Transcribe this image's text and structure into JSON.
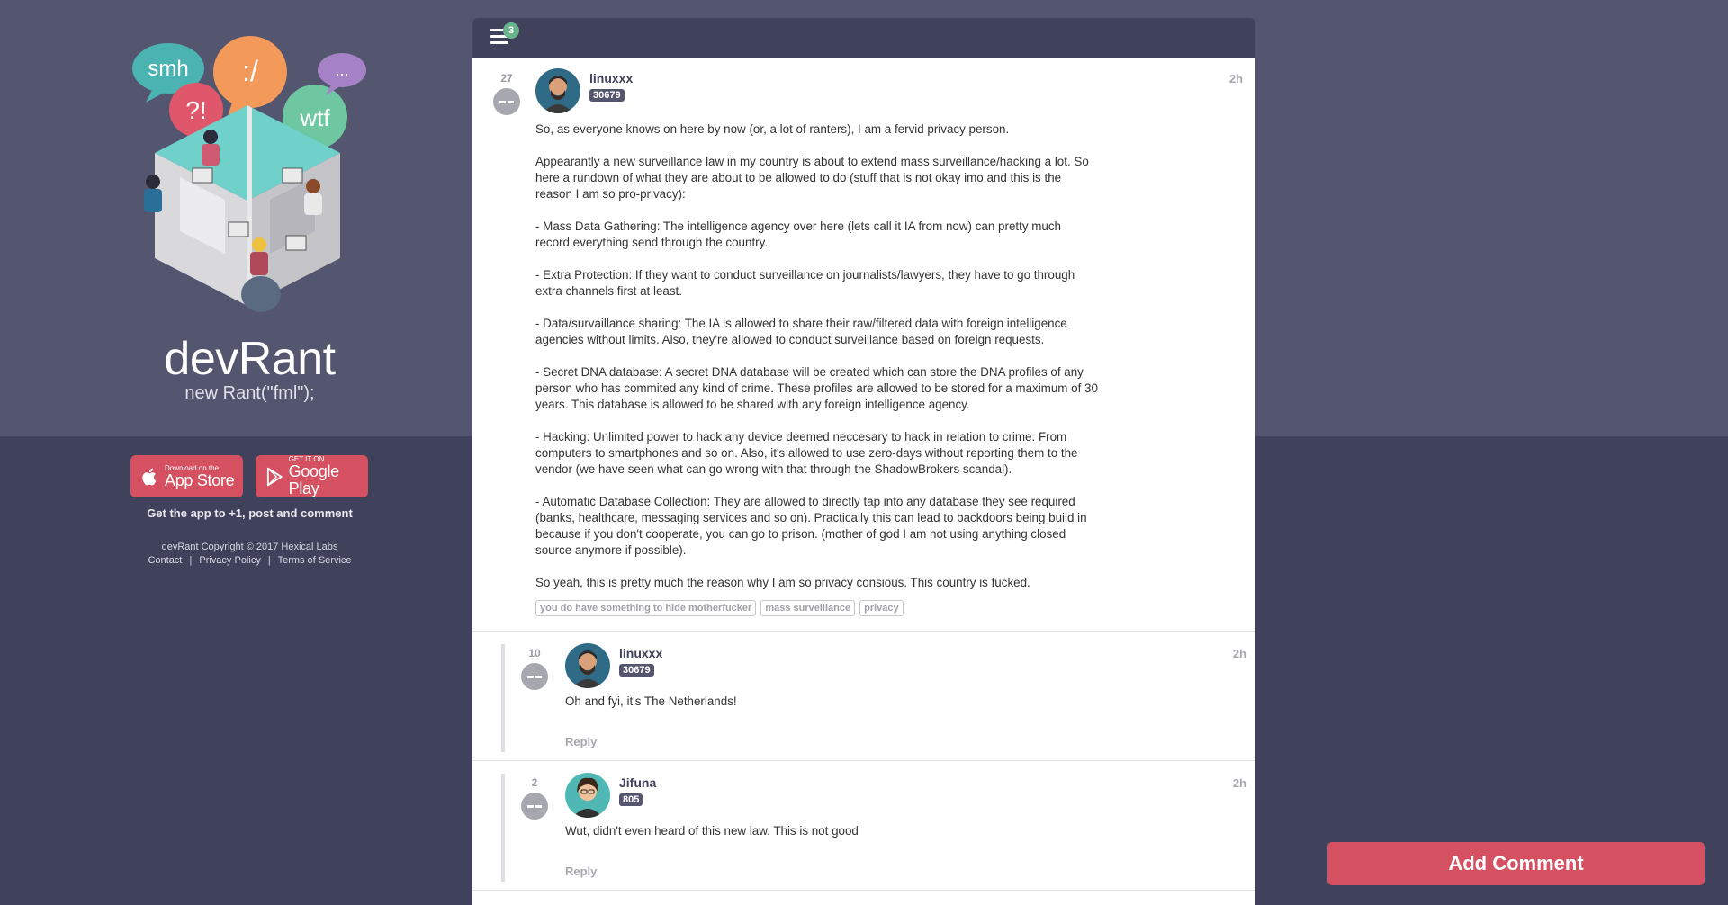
{
  "brand": {
    "name": "devRant",
    "tagline": "new Rant(\"fml\");"
  },
  "illustration": {
    "bubbles": [
      "smh",
      ":/",
      "?!",
      "wtf",
      "..."
    ]
  },
  "stores": {
    "appstore": {
      "small": "Download on the",
      "big": "App Store"
    },
    "googleplay": {
      "small": "GET IT ON",
      "big": "Google Play"
    }
  },
  "get_app_text": "Get the app to +1, post and comment",
  "footer": {
    "copyright": "devRant Copyright © 2017 Hexical Labs",
    "links": [
      "Contact",
      "Privacy Policy",
      "Terms of Service"
    ],
    "separator": "|"
  },
  "topbar": {
    "notification_count": "3"
  },
  "rant": {
    "score": "27",
    "username": "linuxxx",
    "user_score": "30679",
    "time": "2h",
    "paragraphs": [
      "So, as everyone knows on here by now (or, a lot of ranters), I am a fervid privacy person.",
      "Appearantly a new surveillance law in my country is about to extend mass surveillance/hacking a lot. So here a rundown of what they are about to be allowed to do (stuff that is not okay imo and this is the reason I am so pro-privacy):",
      "- Mass Data Gathering: The intelligence agency over here (lets call it IA from now) can pretty much record everything send through the country.",
      "- Extra Protection: If they want to conduct surveillance on journalists/lawyers, they have to go through extra channels first at least.",
      "- Data/survaillance sharing: The IA is allowed to share their raw/filtered data with foreign intelligence agencies without limits. Also, they're allowed to conduct surveillance based on foreign requests.",
      "- Secret DNA database: A secret DNA database will be created which can store the DNA profiles of any person who has commited any kind of crime. These profiles are allowed to be stored for a maximum of 30 years. This database is allowed to be shared with any foreign intelligence agency.",
      "- Hacking: Unlimited power to hack any device deemed neccesary to hack in relation to crime. From computers to smartphones and so on. Also, it's allowed to use zero-days without reporting them to the vendor (we have seen what can go wrong with that through the ShadowBrokers scandal).",
      "- Automatic Database Collection: They are allowed to directly tap into any database they see required (banks, healthcare, messaging services and so on). Practically this can lead to backdoors being build in because if you don't cooperate, you can go to prison. (mother of god I am not using anything closed source anymore if possible).",
      "So yeah, this is pretty much the reason why I am so privacy consious. This country is fucked."
    ],
    "tags": [
      "you do have something to hide motherfucker",
      "mass surveillance",
      "privacy"
    ]
  },
  "comments": [
    {
      "score": "10",
      "username": "linuxxx",
      "user_score": "30679",
      "time": "2h",
      "text": "Oh and fyi, it's The Netherlands!",
      "reply_label": "Reply"
    },
    {
      "score": "2",
      "username": "Jifuna",
      "user_score": "805",
      "time": "2h",
      "text": "Wut, didn't even heard of this new law. This is not good",
      "reply_label": "Reply"
    }
  ],
  "add_comment_label": "Add Comment",
  "colors": {
    "background": "#40415a",
    "top_band": "#54556e",
    "accent": "#d55161",
    "badge": "#6ab48c"
  }
}
